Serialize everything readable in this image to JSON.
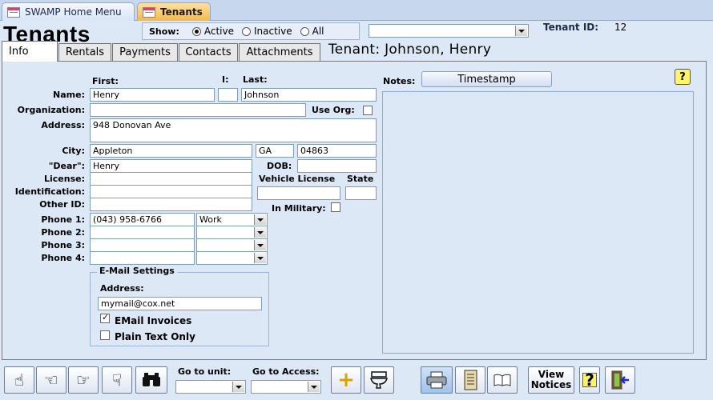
{
  "doc_tabs": [
    {
      "label": "SWAMP Home Menu"
    },
    {
      "label": "Tenants"
    }
  ],
  "form_title": "Tenants",
  "show": {
    "label": "Show:",
    "options": [
      "Active",
      "Inactive",
      "All"
    ],
    "selected": "Active"
  },
  "tenant_id": {
    "label": "Tenant ID:",
    "value": "12"
  },
  "tabs": [
    "Info",
    "Rentals",
    "Payments",
    "Contacts",
    "Attachments"
  ],
  "active_tab": "Info",
  "tenant_header": "Tenant: Johnson, Henry",
  "name": {
    "label": "Name:",
    "first_label": "First:",
    "initial_label": "I:",
    "last_label": "Last:",
    "first": "Henry",
    "initial": "",
    "last": "Johnson"
  },
  "organization": {
    "label": "Organization:",
    "value": "",
    "use_org_label": "Use Org:"
  },
  "address": {
    "label": "Address:",
    "value": "948 Donovan Ave"
  },
  "city": {
    "label": "City:",
    "value": "Appleton",
    "state": "GA",
    "zip": "04863"
  },
  "dear": {
    "label": "\"Dear\":",
    "value": "Henry"
  },
  "dob": {
    "label": "DOB:",
    "value": ""
  },
  "license": {
    "label": "License:",
    "value": ""
  },
  "vehicle": {
    "label": "Vehicle License",
    "state_label": "State",
    "value": "",
    "state": ""
  },
  "identification": {
    "label": "Identification:",
    "value": ""
  },
  "other_id": {
    "label": "Other ID:",
    "value": ""
  },
  "military": {
    "label": "In Military:"
  },
  "phones": [
    {
      "label": "Phone 1:",
      "number": "(043) 958-6766",
      "type": "Work"
    },
    {
      "label": "Phone 2:",
      "number": "",
      "type": ""
    },
    {
      "label": "Phone 3:",
      "number": "",
      "type": ""
    },
    {
      "label": "Phone 4:",
      "number": "",
      "type": ""
    }
  ],
  "email": {
    "title": "E-Mail Settings",
    "address_label": "Address:",
    "address": "mymail@cox.net",
    "invoices_label": "EMail Invoices",
    "invoices_checked": true,
    "plain_label": "Plain Text Only",
    "plain_checked": false
  },
  "notes": {
    "label": "Notes:",
    "timestamp_label": "Timestamp"
  },
  "help_glyph": "?",
  "toolbar": {
    "go_to_unit_label": "Go to unit:",
    "go_to_access_label": "Go to Access:",
    "view_notices_label": "View Notices"
  },
  "icons": {
    "nav_first": "hand-up-icon",
    "nav_prev": "hand-left-icon",
    "nav_next": "hand-right-icon",
    "nav_last": "hand-down-icon",
    "find": "binoculars-icon",
    "add": "plus-icon",
    "delete": "toilet-icon",
    "print": "printer-icon",
    "ledger": "notebook-icon",
    "book": "book-icon",
    "help": "help-icon",
    "exit": "exit-door-icon"
  },
  "colors": {
    "background": "#dde8f7",
    "active_doc_tab": "#f7b84a",
    "help_yellow": "#fff56a"
  }
}
